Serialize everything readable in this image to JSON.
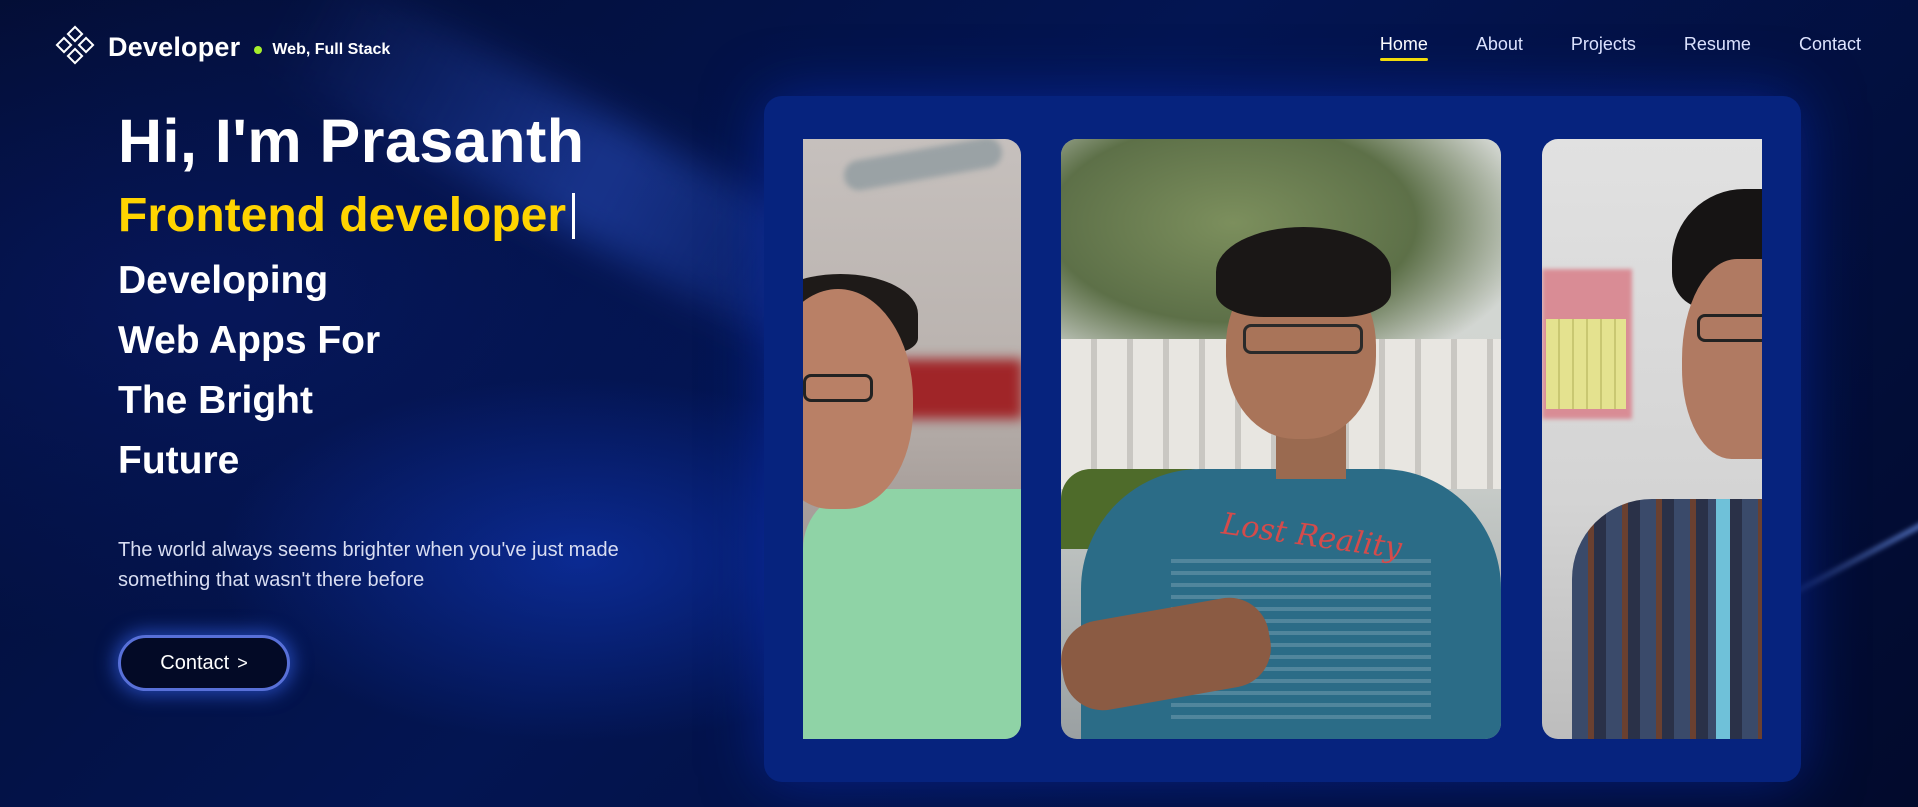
{
  "header": {
    "brand_name": "Developer",
    "tagline": "Web, Full Stack",
    "nav": [
      {
        "label": "Home",
        "active": true
      },
      {
        "label": "About",
        "active": false
      },
      {
        "label": "Projects",
        "active": false
      },
      {
        "label": "Resume",
        "active": false
      },
      {
        "label": "Contact",
        "active": false
      }
    ]
  },
  "hero": {
    "greeting": "Hi, I'm Prasanth",
    "role": "Frontend developer",
    "lines": [
      "Developing",
      "Web Apps For",
      "The Bright",
      "Future"
    ],
    "quote": "The world always seems brighter when you've just made something that wasn't there before",
    "cta_label": "Contact",
    "cta_icon": "chevron-right-icon"
  },
  "carousel": {
    "slide_count": 3,
    "active_slide": 2
  },
  "colors": {
    "accent_yellow": "#ffd400",
    "status_green": "#a6ef2c",
    "background": "#020a2a",
    "carousel_panel": "#06237e"
  }
}
